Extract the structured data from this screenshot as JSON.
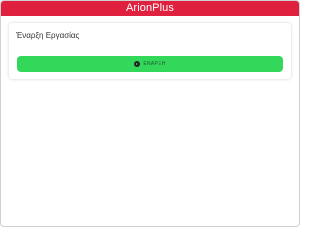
{
  "app": {
    "title": "ArionPlus",
    "brand_color": "#e0203f"
  },
  "work_card": {
    "title": "Έναρξη Εργασίας",
    "start_button": {
      "label": "ΕΝΑΡΞΗ",
      "icon": "play-circle-icon",
      "color": "#33d85a"
    }
  }
}
